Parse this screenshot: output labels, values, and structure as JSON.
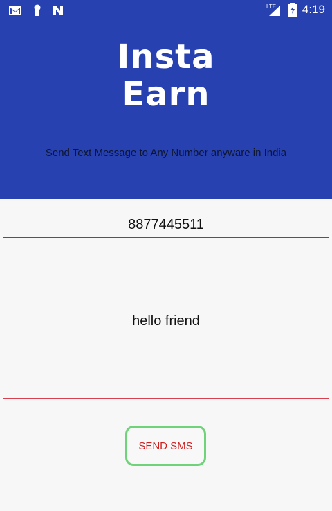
{
  "status_bar": {
    "time": "4:19",
    "network_label": "LTE",
    "icons": [
      "gmail-icon",
      "keyhole-icon",
      "n-icon",
      "signal-icon",
      "battery-icon"
    ]
  },
  "header": {
    "logo_line1": "Insta",
    "logo_line2": "Earn",
    "tagline": "Send Text Message to Any Number anyware in India",
    "color": "#2741b1"
  },
  "form": {
    "phone_value": "8877445511",
    "message_value": "hello friend",
    "send_label": "SEND SMS"
  },
  "colors": {
    "accent_underline": "#d9404f",
    "button_border": "#6fd37a",
    "button_text": "#cc1f1f"
  }
}
